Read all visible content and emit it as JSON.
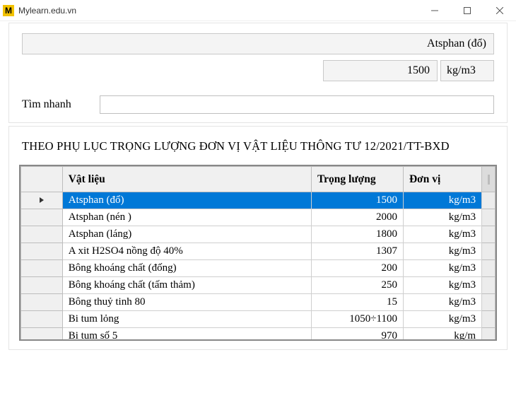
{
  "window": {
    "title": "Mylearn.edu.vn"
  },
  "selected": {
    "name": "Atsphan (đổ)",
    "value": "1500",
    "unit": "kg/m3"
  },
  "search": {
    "label": "Tìm nhanh",
    "value": ""
  },
  "heading": "THEO PHỤ LỤC TRỌNG LƯỢNG ĐƠN VỊ VẬT LIỆU THÔNG TƯ 12/2021/TT-BXD",
  "grid": {
    "headers": {
      "material": "Vật liệu",
      "weight": "Trọng lượng",
      "unit": "Đơn vị"
    },
    "rows": [
      {
        "material": "Atsphan (đổ)",
        "weight": "1500",
        "unit": "kg/m3",
        "selected": true
      },
      {
        "material": "Atsphan (nén )",
        "weight": "2000",
        "unit": "kg/m3"
      },
      {
        "material": "Atsphan (láng)",
        "weight": "1800",
        "unit": "kg/m3"
      },
      {
        "material": "A xit H2SO4 nồng độ 40%",
        "weight": "1307",
        "unit": "kg/m3"
      },
      {
        "material": "Bông khoáng chất (đống)",
        "weight": "200",
        "unit": "kg/m3"
      },
      {
        "material": "Bông khoáng chất (tấm thảm)",
        "weight": "250",
        "unit": "kg/m3"
      },
      {
        "material": "Bông thuỷ tinh 80",
        "weight": "15",
        "unit": "kg/m3"
      },
      {
        "material": "Bi tum lỏng",
        "weight": "1050÷1100",
        "unit": "kg/m3"
      },
      {
        "material": "Bi tum số 5",
        "weight": "970",
        "unit": "kg/m"
      }
    ]
  }
}
